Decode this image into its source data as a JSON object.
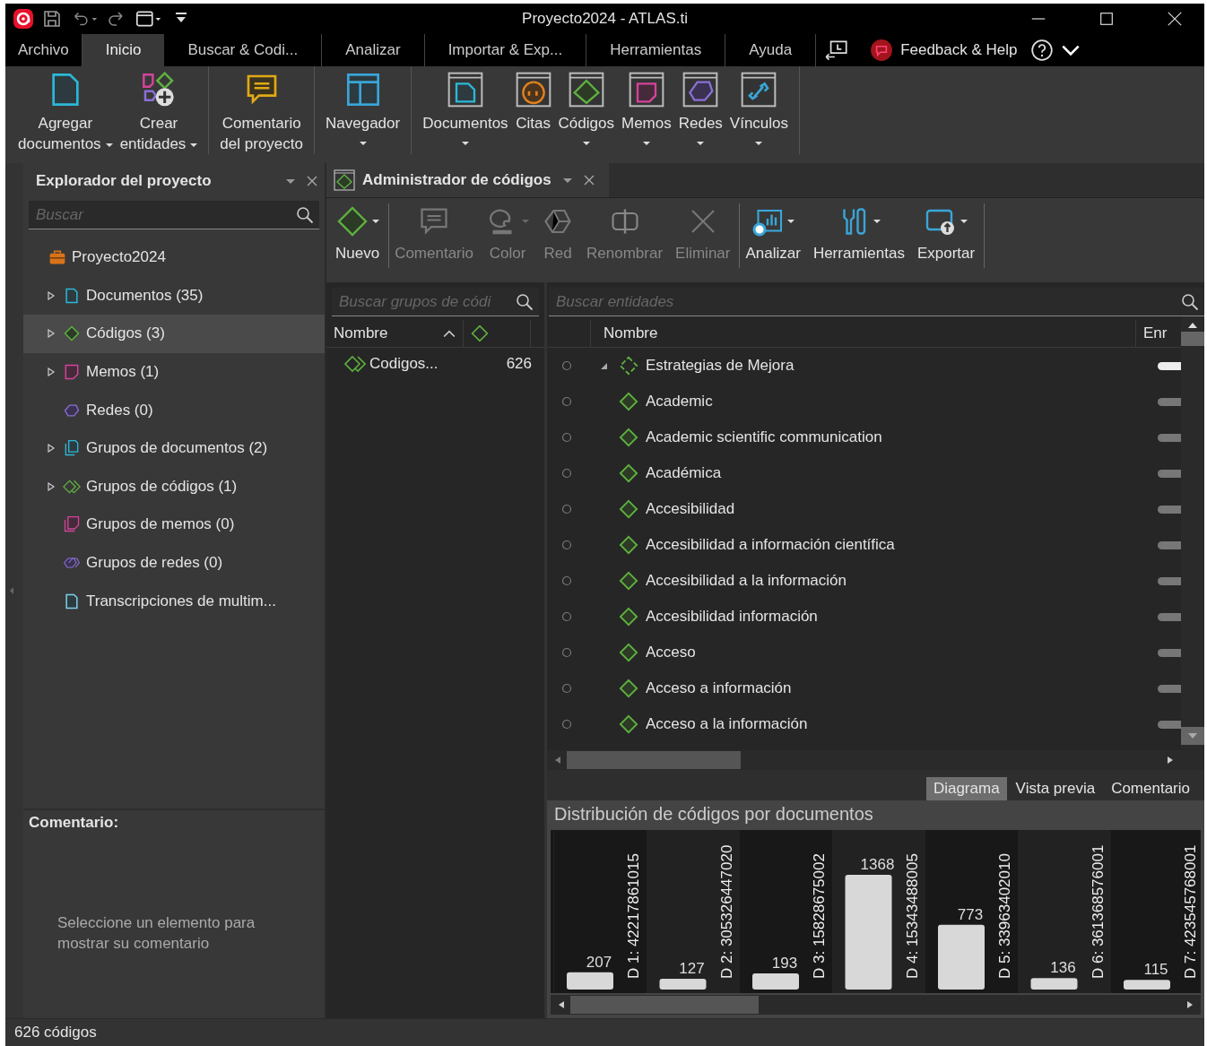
{
  "window": {
    "title": "Proyecto2024 - ATLAS.ti"
  },
  "menu": {
    "tabs": [
      {
        "label": "Archivo",
        "selected": false
      },
      {
        "label": "Inicio",
        "selected": true
      },
      {
        "label": "Buscar & Codi...",
        "selected": false
      },
      {
        "label": "Analizar",
        "selected": false
      },
      {
        "label": "Importar & Exp...",
        "selected": false
      },
      {
        "label": "Herramientas",
        "selected": false
      },
      {
        "label": "Ayuda",
        "selected": false
      }
    ],
    "feedback": "Feedback & Help"
  },
  "ribbon": {
    "groups": [
      {
        "buttons": [
          {
            "kind": "add-doc",
            "label": "Agregar\ndocumentos",
            "dropdown": true
          },
          {
            "kind": "create",
            "label": "Crear\nentidades",
            "dropdown": true
          }
        ]
      },
      {
        "buttons": [
          {
            "kind": "comment",
            "label": "Comentario\ndel proyecto",
            "dropdown": false
          }
        ]
      },
      {
        "buttons": [
          {
            "kind": "navigator",
            "label": "Navegador",
            "dropdown": true
          }
        ]
      },
      {
        "buttons": [
          {
            "kind": "win-doc",
            "label": "Documentos",
            "dropdown": true
          },
          {
            "kind": "win-quote",
            "label": "Citas",
            "dropdown": false
          },
          {
            "kind": "win-code",
            "label": "Códigos",
            "dropdown": true
          },
          {
            "kind": "win-memo",
            "label": "Memos",
            "dropdown": true
          },
          {
            "kind": "win-net",
            "label": "Redes",
            "dropdown": true
          },
          {
            "kind": "win-link",
            "label": "Vínculos",
            "dropdown": true
          }
        ]
      }
    ]
  },
  "explorer": {
    "title": "Explorador del proyecto",
    "search": {
      "placeholder": "Buscar"
    },
    "tree": [
      {
        "kind": "project",
        "label": "Proyecto2024",
        "expandable": false,
        "selected": false,
        "children": [
          {
            "kind": "documents",
            "label": "Documentos (35)",
            "expandable": true,
            "selected": false
          },
          {
            "kind": "codes",
            "label": "Códigos (3)",
            "expandable": true,
            "selected": true
          },
          {
            "kind": "memos",
            "label": "Memos (1)",
            "expandable": true,
            "selected": false
          },
          {
            "kind": "networks",
            "label": "Redes (0)",
            "expandable": false,
            "selected": false
          },
          {
            "kind": "doc-groups",
            "label": "Grupos de documentos (2)",
            "expandable": true,
            "selected": false
          },
          {
            "kind": "code-groups",
            "label": "Grupos de códigos (1)",
            "expandable": true,
            "selected": false
          },
          {
            "kind": "memo-groups",
            "label": "Grupos de memos (0)",
            "expandable": false,
            "selected": false
          },
          {
            "kind": "net-groups",
            "label": "Grupos de redes (0)",
            "expandable": false,
            "selected": false
          },
          {
            "kind": "transcripts",
            "label": "Transcripciones de multim...",
            "expandable": false,
            "selected": false
          }
        ]
      }
    ],
    "comment": {
      "heading": "Comentario:",
      "text": "Seleccione un elemento para mostrar su comentario"
    }
  },
  "manager": {
    "title": "Administrador de códigos",
    "toolbar": [
      {
        "buttons": [
          {
            "kind": "new",
            "label": "Nuevo",
            "dropdown": true,
            "disabled": false
          }
        ]
      },
      {
        "buttons": [
          {
            "kind": "comment",
            "label": "Comentario",
            "dropdown": false,
            "disabled": true
          },
          {
            "kind": "color",
            "label": "Color",
            "dropdown": true,
            "disabled": true
          },
          {
            "kind": "network",
            "label": "Red",
            "dropdown": false,
            "disabled": true
          },
          {
            "kind": "rename",
            "label": "Renombrar",
            "dropdown": false,
            "disabled": true
          },
          {
            "kind": "delete",
            "label": "Eliminar",
            "dropdown": false,
            "disabled": true
          }
        ]
      },
      {
        "buttons": [
          {
            "kind": "analyze",
            "label": "Analizar",
            "dropdown": true,
            "disabled": false
          },
          {
            "kind": "tools",
            "label": "Herramientas",
            "dropdown": true,
            "disabled": false
          },
          {
            "kind": "export",
            "label": "Exportar",
            "dropdown": true,
            "disabled": false
          }
        ]
      }
    ],
    "groups_panel": {
      "search": {
        "placeholder": "Buscar grupos de códi"
      },
      "columns": [
        "Nombre"
      ],
      "rows": [
        {
          "name": "Codigos...",
          "count": "626",
          "selected": false
        }
      ]
    },
    "entities_panel": {
      "search": {
        "placeholder": "Buscar entidades"
      },
      "columns": [
        "Nombre",
        "Enr"
      ],
      "rows": [
        {
          "kind": "group",
          "name": "Estrategias de Mejora",
          "expanded": true,
          "children": [
            {
              "kind": "code",
              "name": "Academic"
            },
            {
              "kind": "code",
              "name": "Academic scientific communication"
            },
            {
              "kind": "code",
              "name": "Académica"
            },
            {
              "kind": "code",
              "name": "Accesibilidad"
            },
            {
              "kind": "code",
              "name": "Accesibilidad a información científica"
            },
            {
              "kind": "code",
              "name": "Accesibilidad a la información"
            },
            {
              "kind": "code",
              "name": "Accesibilidad información"
            },
            {
              "kind": "code",
              "name": "Acceso"
            },
            {
              "kind": "code",
              "name": "Acceso a información"
            },
            {
              "kind": "code",
              "name": "Acceso a la información"
            }
          ]
        }
      ]
    },
    "detail_tabs": [
      {
        "label": "Diagrama",
        "selected": true
      },
      {
        "label": "Vista previa",
        "selected": false
      },
      {
        "label": "Comentario",
        "selected": false
      }
    ],
    "chart_data": {
      "type": "bar",
      "title": "Distribución de códigos por documentos",
      "categories": [
        "D 1: 42217861015",
        "D 2: 305326447020",
        "D 3: 15828675002",
        "D 4: 15343488005",
        "D 5: 33963402010",
        "D 6: 361368576001",
        "D 7: 423545768001"
      ],
      "values": [
        207,
        127,
        193,
        1368,
        773,
        136,
        115
      ],
      "data_labels": true
    }
  },
  "status_bar": "626 códigos"
}
